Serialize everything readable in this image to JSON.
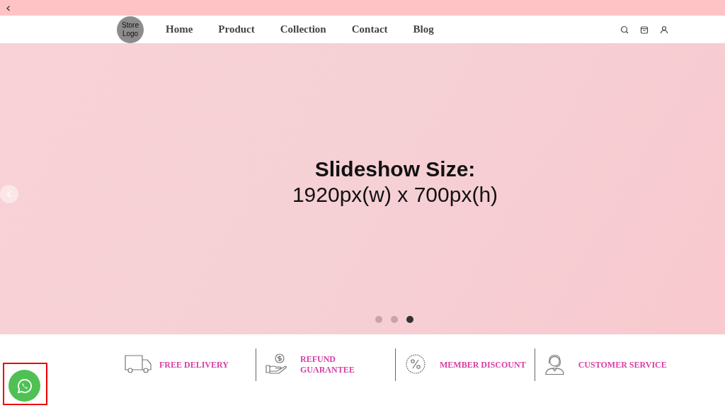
{
  "top_bar": {
    "back": "‹"
  },
  "header": {
    "logo": "Store Logo",
    "nav": [
      {
        "label": "Home"
      },
      {
        "label": "Product"
      },
      {
        "label": "Collection"
      },
      {
        "label": "Contact"
      },
      {
        "label": "Blog"
      }
    ],
    "actions": [
      {
        "kind": "search"
      },
      {
        "kind": "bag"
      },
      {
        "kind": "account"
      }
    ]
  },
  "slideshow": {
    "title": "Slideshow Size:",
    "subtitle": "1920px(w) x 700px(h)",
    "dots": [
      {
        "selected": false
      },
      {
        "selected": false
      },
      {
        "selected": true
      }
    ]
  },
  "features": [
    {
      "kind": "truck",
      "label": "FREE DELIVERY"
    },
    {
      "kind": "refund",
      "label": "REFUND GUARANTEE"
    },
    {
      "kind": "discount",
      "label": "MEMBER DISCOUNT"
    },
    {
      "kind": "support",
      "label": "CUSTOMER SERVICE"
    }
  ],
  "chat_button": {
    "kind": "whatsapp",
    "highlighted": true
  }
}
